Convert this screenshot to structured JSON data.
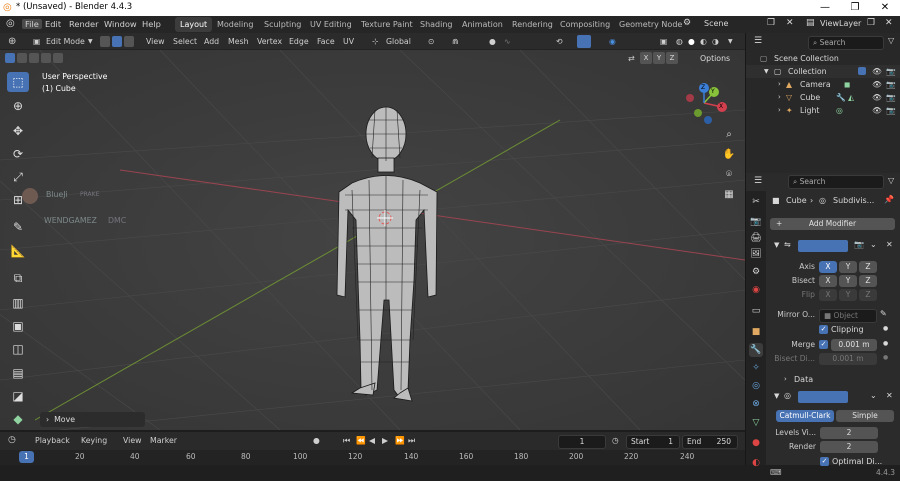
{
  "window": {
    "title": "* (Unsaved) - Blender 4.4.3",
    "minimize": "—",
    "maximize": "❐",
    "close": "✕"
  },
  "menubar": {
    "items": [
      "File",
      "Edit",
      "Render",
      "Window",
      "Help"
    ],
    "workspaces": [
      "Layout",
      "Modeling",
      "Sculpting",
      "UV Editing",
      "Texture Paint",
      "Shading",
      "Animation",
      "Rendering",
      "Compositing",
      "Geometry Node"
    ],
    "scene": "Scene",
    "view_layer": "ViewLayer"
  },
  "viewport_header": {
    "mode": "Edit Mode",
    "menus": [
      "View",
      "Select",
      "Add",
      "Mesh",
      "Vertex",
      "Edge",
      "Face",
      "UV"
    ],
    "transform_orientation": "Global",
    "axis_x": "X",
    "axis_y": "Y",
    "axis_z": "Z",
    "options": "Options"
  },
  "viewport": {
    "view_name": "User Perspective",
    "object_name": "(1) Cube",
    "watermark_1": "BlueJi",
    "watermark_1b": "PRAKE",
    "watermark_2": "WENDGAMEZ",
    "watermark_2b": "DMC",
    "last_op": "Move",
    "gizmo_x": "X",
    "gizmo_y": "Y",
    "gizmo_z": "Z"
  },
  "timeline": {
    "menus": [
      "Playback",
      "Keying",
      "View",
      "Marker"
    ],
    "current_frame": "1",
    "start_label": "Start",
    "start": "1",
    "end_label": "End",
    "end": "250",
    "ticks": [
      "1",
      "20",
      "40",
      "60",
      "80",
      "100",
      "120",
      "140",
      "160",
      "180",
      "200",
      "220",
      "240"
    ]
  },
  "outliner": {
    "search_placeholder": "Search",
    "root": "Scene Collection",
    "collection": "Collection",
    "items": [
      "Camera",
      "Cube",
      "Light"
    ]
  },
  "properties": {
    "search_placeholder": "Search",
    "breadcrumb_object": "Cube",
    "breadcrumb_modifier": "Subdivis...",
    "add_modifier": "Add Modifier",
    "mirror": {
      "axis_label": "Axis",
      "bisect_label": "Bisect",
      "flip_label": "Flip",
      "x": "X",
      "y": "Y",
      "z": "Z",
      "mirror_object_label": "Mirror O...",
      "mirror_object_placeholder": "Object",
      "clipping": "Clipping",
      "merge_label": "Merge",
      "merge_value": "0.001 m",
      "bisect_distance_label": "Bisect Di...",
      "bisect_distance_value": "0.001 m",
      "data": "Data"
    },
    "subdiv": {
      "catmull": "Catmull-Clark",
      "simple": "Simple",
      "levels_label": "Levels Vi...",
      "levels_value": "2",
      "render_label": "Render",
      "render_value": "2",
      "optimal": "Optimal Di..."
    }
  },
  "status": {
    "version": "4.4.3"
  },
  "colors": {
    "accent": "#4772b3",
    "x_axis": "#d43f4e",
    "y_axis": "#88c23a",
    "z_axis": "#3b7fd8",
    "viewport_bg": "#3c3c3c"
  }
}
